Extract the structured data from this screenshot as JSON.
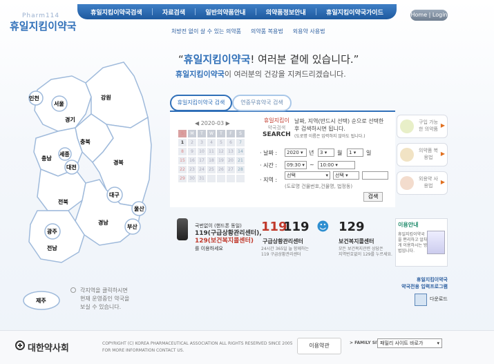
{
  "logo": {
    "en": "Pharm114",
    "ko": "휴일지킴이약국"
  },
  "topnav": [
    "휴일지킴이약국검색",
    "자료검색",
    "일반의약품안내",
    "의약품정보안내",
    "휴일지킴이약국가이드"
  ],
  "home_login": "Home | Login",
  "subnav": [
    "처방전 없이 살 수 있는 의약품",
    "의약품 복용법",
    "외용약 사용법"
  ],
  "headline": {
    "brand": "휴일지킴이약국",
    "q_open": "“",
    "rest": "! 여러분 곁에 있습니다.”",
    "line2_brand": "휴일지킴이약국",
    "line2_rest": "이 여러분의 건강을 지켜드리겠습니다."
  },
  "map": {
    "regions": [
      {
        "id": "incheon",
        "label": "인천"
      },
      {
        "id": "seoul",
        "label": "서울"
      },
      {
        "id": "gyeonggi",
        "label": "경기"
      },
      {
        "id": "gangwon",
        "label": "강원"
      },
      {
        "id": "chungbuk",
        "label": "충북"
      },
      {
        "id": "chungnam",
        "label": "충남"
      },
      {
        "id": "sejong",
        "label": "세종"
      },
      {
        "id": "daejeon",
        "label": "대전"
      },
      {
        "id": "gyeongbuk",
        "label": "경북"
      },
      {
        "id": "daegu",
        "label": "대구"
      },
      {
        "id": "jeonbuk",
        "label": "전북"
      },
      {
        "id": "ulsan",
        "label": "울산"
      },
      {
        "id": "gyeongnam",
        "label": "경남"
      },
      {
        "id": "busan",
        "label": "부산"
      },
      {
        "id": "gwangju",
        "label": "광주"
      },
      {
        "id": "jeonnam",
        "label": "전남"
      },
      {
        "id": "jeju",
        "label": "제주"
      }
    ],
    "hint": [
      "각지역을 클릭하시면",
      "현재 운영중인 약국을",
      "보실 수 있습니다."
    ]
  },
  "tabs": [
    "휴일지킴이약국 검색",
    "연중무휴약국 검색"
  ],
  "calendar": {
    "title": "◀ 2020-03 ▶",
    "days": [
      "S",
      "M",
      "T",
      "W",
      "T",
      "F",
      "S"
    ],
    "weeks": [
      [
        "1",
        "2",
        "3",
        "4",
        "5",
        "6",
        "7"
      ],
      [
        "8",
        "9",
        "10",
        "11",
        "12",
        "13",
        "14"
      ],
      [
        "15",
        "16",
        "17",
        "18",
        "19",
        "20",
        "21"
      ],
      [
        "22",
        "23",
        "24",
        "25",
        "26",
        "27",
        "28"
      ],
      [
        "29",
        "30",
        "31",
        "",
        "",
        "",
        ""
      ]
    ]
  },
  "search": {
    "logo_a": "휴일지킴이",
    "logo_b": "약국검색",
    "logo_c": "SEARCH",
    "desc1": "날짜, 지역(반드시 선택) 순으로 선택한",
    "desc2": "후 검색하시면 됩니다.",
    "desc3": "(도로명 이름은 입력하지 않아도 됩니다.)",
    "date_label": "· 날짜 :",
    "year": "2020",
    "year_unit": "년",
    "month": "3",
    "month_unit": "월",
    "day": "1",
    "day_unit": "일",
    "time_label": "· 시간 :",
    "time_from": "09:30",
    "tilde": "~",
    "time_to": "10:00",
    "region_label": "· 지역 :",
    "region1": "선택",
    "region2": "선택",
    "address_placeholder": "",
    "addr_hint": "(도로명 건물번호,건물명, 법정동)",
    "button": "검색"
  },
  "right_buttons": [
    {
      "text": "구입 가능한 의약품"
    },
    {
      "text": "의약품 복용법"
    },
    {
      "text": "외용약 사용법"
    }
  ],
  "info": {
    "line1": "국번없이 (핸드폰 동일)",
    "line2": "119(구급상황관리센터),",
    "line3": "129(보건복지콜센터)",
    "line4": "를 이용하세요",
    "n119": "119",
    "n119_title": "구급상황관리센터",
    "n119_sub": [
      "24시간 365일 늘 함께하는",
      "119 구급상황관리센터"
    ],
    "n129": "129",
    "n129_title": "보건복지콜센터",
    "n129_sub": [
      "모든 보건복지관련 상담은",
      "지역번호없이 129를 누르세요."
    ]
  },
  "usage": {
    "title": "이용안내",
    "desc": "휴일지킴이약국을 편리하고 알차게 이용하시는 방법입니다."
  },
  "program": {
    "line1": "휴일지킴이약국",
    "line2": "약국전용 입력프로그램",
    "line3": "다운로드"
  },
  "footer": {
    "org": "대한약사회",
    "copyright": "COPYRIGHT (C) KOREA PHARMACEUTICAL ASSOCIATION ALL RIGHTS RESERVED SINCE 2005",
    "contact": "FOR MORE INFORMATION CONTACT US.",
    "terms": "이용약관",
    "family_label": "> FAMILY SITE",
    "family_value": "패밀리 사이트 바로가"
  },
  "colors": {
    "brand": "#2f6fb8",
    "nav": "#1e5a9f",
    "accent": "#c0392b",
    "map_stroke": "#9fbadb"
  }
}
